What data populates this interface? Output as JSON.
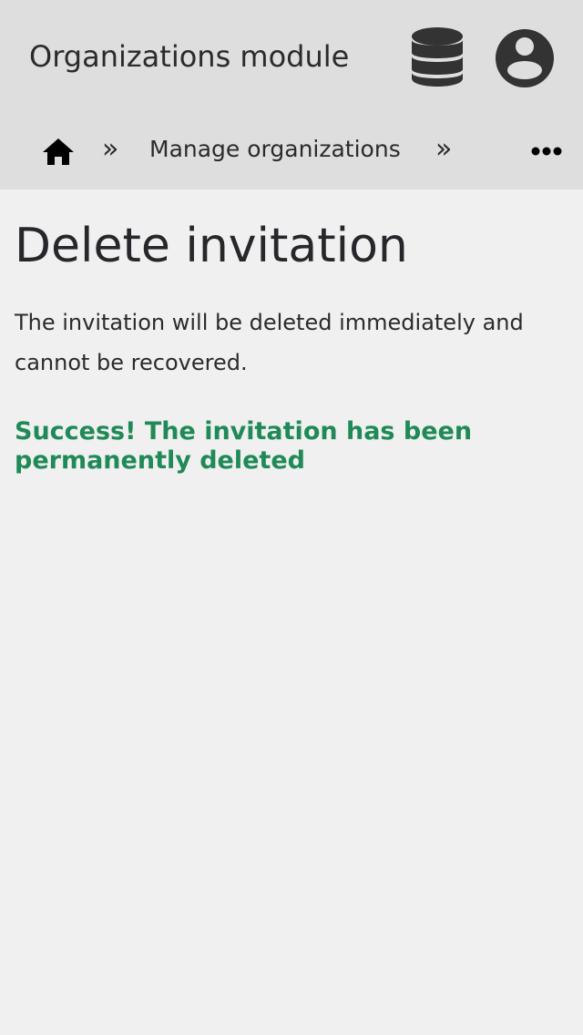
{
  "header": {
    "app_title": "Organizations module",
    "database_icon": "database-icon",
    "account_icon": "account-circle-icon"
  },
  "breadcrumb": {
    "home_icon": "home-icon",
    "separator": "»",
    "items": [
      {
        "label": "Manage organizations"
      }
    ],
    "more_icon": "more-horizontal-icon"
  },
  "main": {
    "title": "Delete invitation",
    "description": "The invitation will be deleted immediately and cannot be recovered.",
    "success_message": "Success! The invitation has been permanently deleted"
  },
  "colors": {
    "header_bg": "#dedede",
    "page_bg": "#f0f0f0",
    "success": "#1f8a57",
    "icon_dark": "#333333"
  }
}
